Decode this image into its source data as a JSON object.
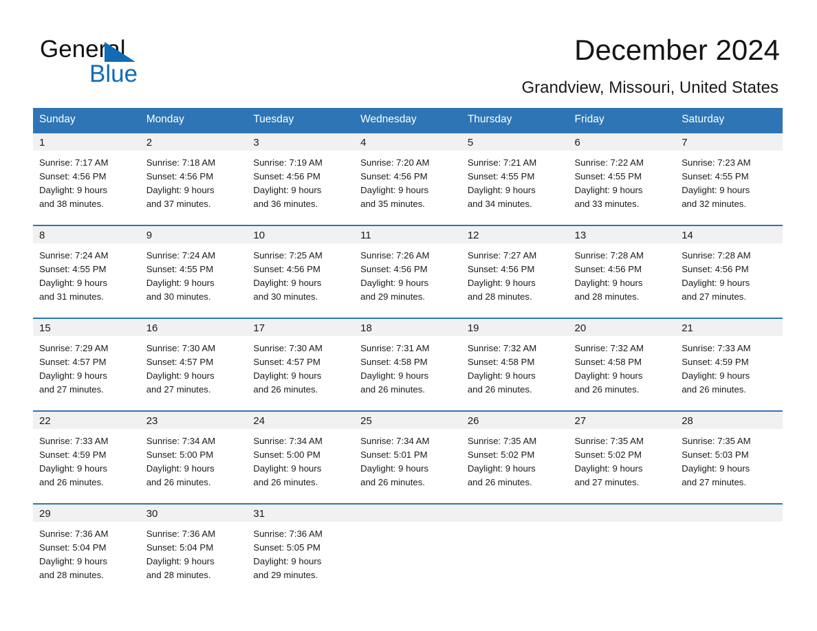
{
  "brand": {
    "line1": "General",
    "line2": "Blue",
    "triangle_color": "#0f6cb5"
  },
  "header": {
    "title": "December 2024",
    "subtitle": "Grandview, Missouri, United States"
  },
  "theme": {
    "header_blue": "#2e75b6",
    "daynum_band": "#f1f1f1",
    "text": "#1a1a1a"
  },
  "calendar": {
    "weekday_headers": [
      "Sunday",
      "Monday",
      "Tuesday",
      "Wednesday",
      "Thursday",
      "Friday",
      "Saturday"
    ],
    "weeks": [
      [
        {
          "day": "1",
          "sunrise": "Sunrise: 7:17 AM",
          "sunset": "Sunset: 4:56 PM",
          "daylight_1": "Daylight: 9 hours",
          "daylight_2": "and 38 minutes."
        },
        {
          "day": "2",
          "sunrise": "Sunrise: 7:18 AM",
          "sunset": "Sunset: 4:56 PM",
          "daylight_1": "Daylight: 9 hours",
          "daylight_2": "and 37 minutes."
        },
        {
          "day": "3",
          "sunrise": "Sunrise: 7:19 AM",
          "sunset": "Sunset: 4:56 PM",
          "daylight_1": "Daylight: 9 hours",
          "daylight_2": "and 36 minutes."
        },
        {
          "day": "4",
          "sunrise": "Sunrise: 7:20 AM",
          "sunset": "Sunset: 4:56 PM",
          "daylight_1": "Daylight: 9 hours",
          "daylight_2": "and 35 minutes."
        },
        {
          "day": "5",
          "sunrise": "Sunrise: 7:21 AM",
          "sunset": "Sunset: 4:55 PM",
          "daylight_1": "Daylight: 9 hours",
          "daylight_2": "and 34 minutes."
        },
        {
          "day": "6",
          "sunrise": "Sunrise: 7:22 AM",
          "sunset": "Sunset: 4:55 PM",
          "daylight_1": "Daylight: 9 hours",
          "daylight_2": "and 33 minutes."
        },
        {
          "day": "7",
          "sunrise": "Sunrise: 7:23 AM",
          "sunset": "Sunset: 4:55 PM",
          "daylight_1": "Daylight: 9 hours",
          "daylight_2": "and 32 minutes."
        }
      ],
      [
        {
          "day": "8",
          "sunrise": "Sunrise: 7:24 AM",
          "sunset": "Sunset: 4:55 PM",
          "daylight_1": "Daylight: 9 hours",
          "daylight_2": "and 31 minutes."
        },
        {
          "day": "9",
          "sunrise": "Sunrise: 7:24 AM",
          "sunset": "Sunset: 4:55 PM",
          "daylight_1": "Daylight: 9 hours",
          "daylight_2": "and 30 minutes."
        },
        {
          "day": "10",
          "sunrise": "Sunrise: 7:25 AM",
          "sunset": "Sunset: 4:56 PM",
          "daylight_1": "Daylight: 9 hours",
          "daylight_2": "and 30 minutes."
        },
        {
          "day": "11",
          "sunrise": "Sunrise: 7:26 AM",
          "sunset": "Sunset: 4:56 PM",
          "daylight_1": "Daylight: 9 hours",
          "daylight_2": "and 29 minutes."
        },
        {
          "day": "12",
          "sunrise": "Sunrise: 7:27 AM",
          "sunset": "Sunset: 4:56 PM",
          "daylight_1": "Daylight: 9 hours",
          "daylight_2": "and 28 minutes."
        },
        {
          "day": "13",
          "sunrise": "Sunrise: 7:28 AM",
          "sunset": "Sunset: 4:56 PM",
          "daylight_1": "Daylight: 9 hours",
          "daylight_2": "and 28 minutes."
        },
        {
          "day": "14",
          "sunrise": "Sunrise: 7:28 AM",
          "sunset": "Sunset: 4:56 PM",
          "daylight_1": "Daylight: 9 hours",
          "daylight_2": "and 27 minutes."
        }
      ],
      [
        {
          "day": "15",
          "sunrise": "Sunrise: 7:29 AM",
          "sunset": "Sunset: 4:57 PM",
          "daylight_1": "Daylight: 9 hours",
          "daylight_2": "and 27 minutes."
        },
        {
          "day": "16",
          "sunrise": "Sunrise: 7:30 AM",
          "sunset": "Sunset: 4:57 PM",
          "daylight_1": "Daylight: 9 hours",
          "daylight_2": "and 27 minutes."
        },
        {
          "day": "17",
          "sunrise": "Sunrise: 7:30 AM",
          "sunset": "Sunset: 4:57 PM",
          "daylight_1": "Daylight: 9 hours",
          "daylight_2": "and 26 minutes."
        },
        {
          "day": "18",
          "sunrise": "Sunrise: 7:31 AM",
          "sunset": "Sunset: 4:58 PM",
          "daylight_1": "Daylight: 9 hours",
          "daylight_2": "and 26 minutes."
        },
        {
          "day": "19",
          "sunrise": "Sunrise: 7:32 AM",
          "sunset": "Sunset: 4:58 PM",
          "daylight_1": "Daylight: 9 hours",
          "daylight_2": "and 26 minutes."
        },
        {
          "day": "20",
          "sunrise": "Sunrise: 7:32 AM",
          "sunset": "Sunset: 4:58 PM",
          "daylight_1": "Daylight: 9 hours",
          "daylight_2": "and 26 minutes."
        },
        {
          "day": "21",
          "sunrise": "Sunrise: 7:33 AM",
          "sunset": "Sunset: 4:59 PM",
          "daylight_1": "Daylight: 9 hours",
          "daylight_2": "and 26 minutes."
        }
      ],
      [
        {
          "day": "22",
          "sunrise": "Sunrise: 7:33 AM",
          "sunset": "Sunset: 4:59 PM",
          "daylight_1": "Daylight: 9 hours",
          "daylight_2": "and 26 minutes."
        },
        {
          "day": "23",
          "sunrise": "Sunrise: 7:34 AM",
          "sunset": "Sunset: 5:00 PM",
          "daylight_1": "Daylight: 9 hours",
          "daylight_2": "and 26 minutes."
        },
        {
          "day": "24",
          "sunrise": "Sunrise: 7:34 AM",
          "sunset": "Sunset: 5:00 PM",
          "daylight_1": "Daylight: 9 hours",
          "daylight_2": "and 26 minutes."
        },
        {
          "day": "25",
          "sunrise": "Sunrise: 7:34 AM",
          "sunset": "Sunset: 5:01 PM",
          "daylight_1": "Daylight: 9 hours",
          "daylight_2": "and 26 minutes."
        },
        {
          "day": "26",
          "sunrise": "Sunrise: 7:35 AM",
          "sunset": "Sunset: 5:02 PM",
          "daylight_1": "Daylight: 9 hours",
          "daylight_2": "and 26 minutes."
        },
        {
          "day": "27",
          "sunrise": "Sunrise: 7:35 AM",
          "sunset": "Sunset: 5:02 PM",
          "daylight_1": "Daylight: 9 hours",
          "daylight_2": "and 27 minutes."
        },
        {
          "day": "28",
          "sunrise": "Sunrise: 7:35 AM",
          "sunset": "Sunset: 5:03 PM",
          "daylight_1": "Daylight: 9 hours",
          "daylight_2": "and 27 minutes."
        }
      ],
      [
        {
          "day": "29",
          "sunrise": "Sunrise: 7:36 AM",
          "sunset": "Sunset: 5:04 PM",
          "daylight_1": "Daylight: 9 hours",
          "daylight_2": "and 28 minutes."
        },
        {
          "day": "30",
          "sunrise": "Sunrise: 7:36 AM",
          "sunset": "Sunset: 5:04 PM",
          "daylight_1": "Daylight: 9 hours",
          "daylight_2": "and 28 minutes."
        },
        {
          "day": "31",
          "sunrise": "Sunrise: 7:36 AM",
          "sunset": "Sunset: 5:05 PM",
          "daylight_1": "Daylight: 9 hours",
          "daylight_2": "and 29 minutes."
        },
        {
          "day": "",
          "sunrise": "",
          "sunset": "",
          "daylight_1": "",
          "daylight_2": ""
        },
        {
          "day": "",
          "sunrise": "",
          "sunset": "",
          "daylight_1": "",
          "daylight_2": ""
        },
        {
          "day": "",
          "sunrise": "",
          "sunset": "",
          "daylight_1": "",
          "daylight_2": ""
        },
        {
          "day": "",
          "sunrise": "",
          "sunset": "",
          "daylight_1": "",
          "daylight_2": ""
        }
      ]
    ]
  }
}
